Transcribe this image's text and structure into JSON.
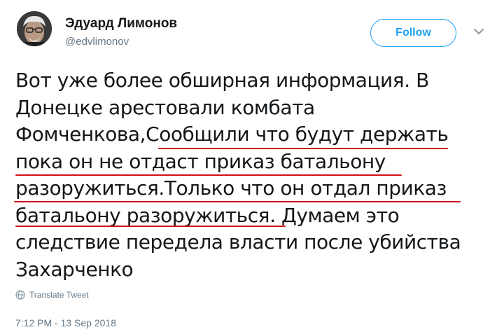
{
  "author": {
    "display_name": "Эдуард Лимонов",
    "handle": "@edvlimonov"
  },
  "follow_button": {
    "label": "Follow"
  },
  "tweet": {
    "lines": [
      "Вот уже более обширная информация. В",
      "Донецке арестовали комбата",
      "Фомченкова,Сообщили что будут держать",
      "пока он не отдаст приказ батальону",
      "разоружиться.Только что он отдал приказ",
      "батальону разоружиться. Думаем это",
      "следствие передела власти после убийства",
      "Захарченко"
    ]
  },
  "translate": {
    "label": "Translate Tweet",
    "icon": "globe-icon"
  },
  "timestamp": "7:12 PM - 13 Sep 2018",
  "colors": {
    "accent": "#1da1f2",
    "underline": "#d01016",
    "secondary_text": "#657786"
  }
}
